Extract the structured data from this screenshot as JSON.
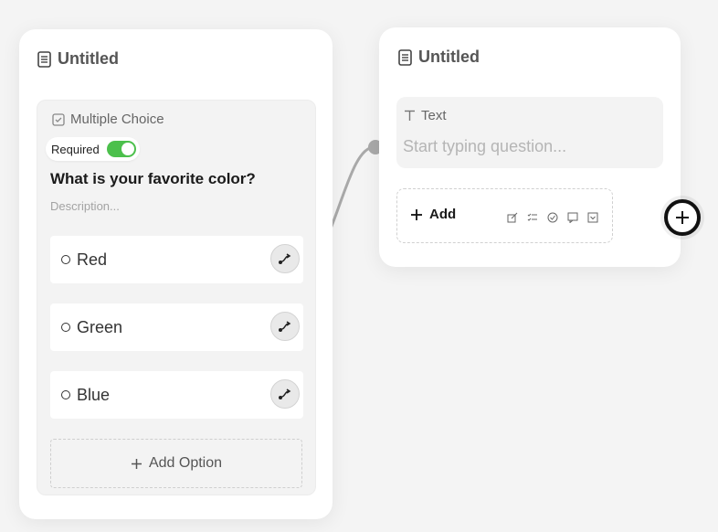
{
  "card_a": {
    "title": "Untitled",
    "question_type": "Multiple Choice",
    "required_label": "Required",
    "required_on": true,
    "question": "What is your favorite color?",
    "description_placeholder": "Description...",
    "options": [
      {
        "label": "Red"
      },
      {
        "label": "Green"
      },
      {
        "label": "Blue"
      }
    ],
    "add_option_label": "Add Option"
  },
  "card_b": {
    "title": "Untitled",
    "block_type": "Text",
    "question_placeholder": "Start typing question...",
    "add_label": "Add",
    "add_icons": [
      "edit-icon",
      "checklist-icon",
      "check-circle-icon",
      "comment-icon",
      "dropdown-icon"
    ]
  },
  "colors": {
    "toggle_on": "#4cc04c",
    "accent": "#111111"
  }
}
